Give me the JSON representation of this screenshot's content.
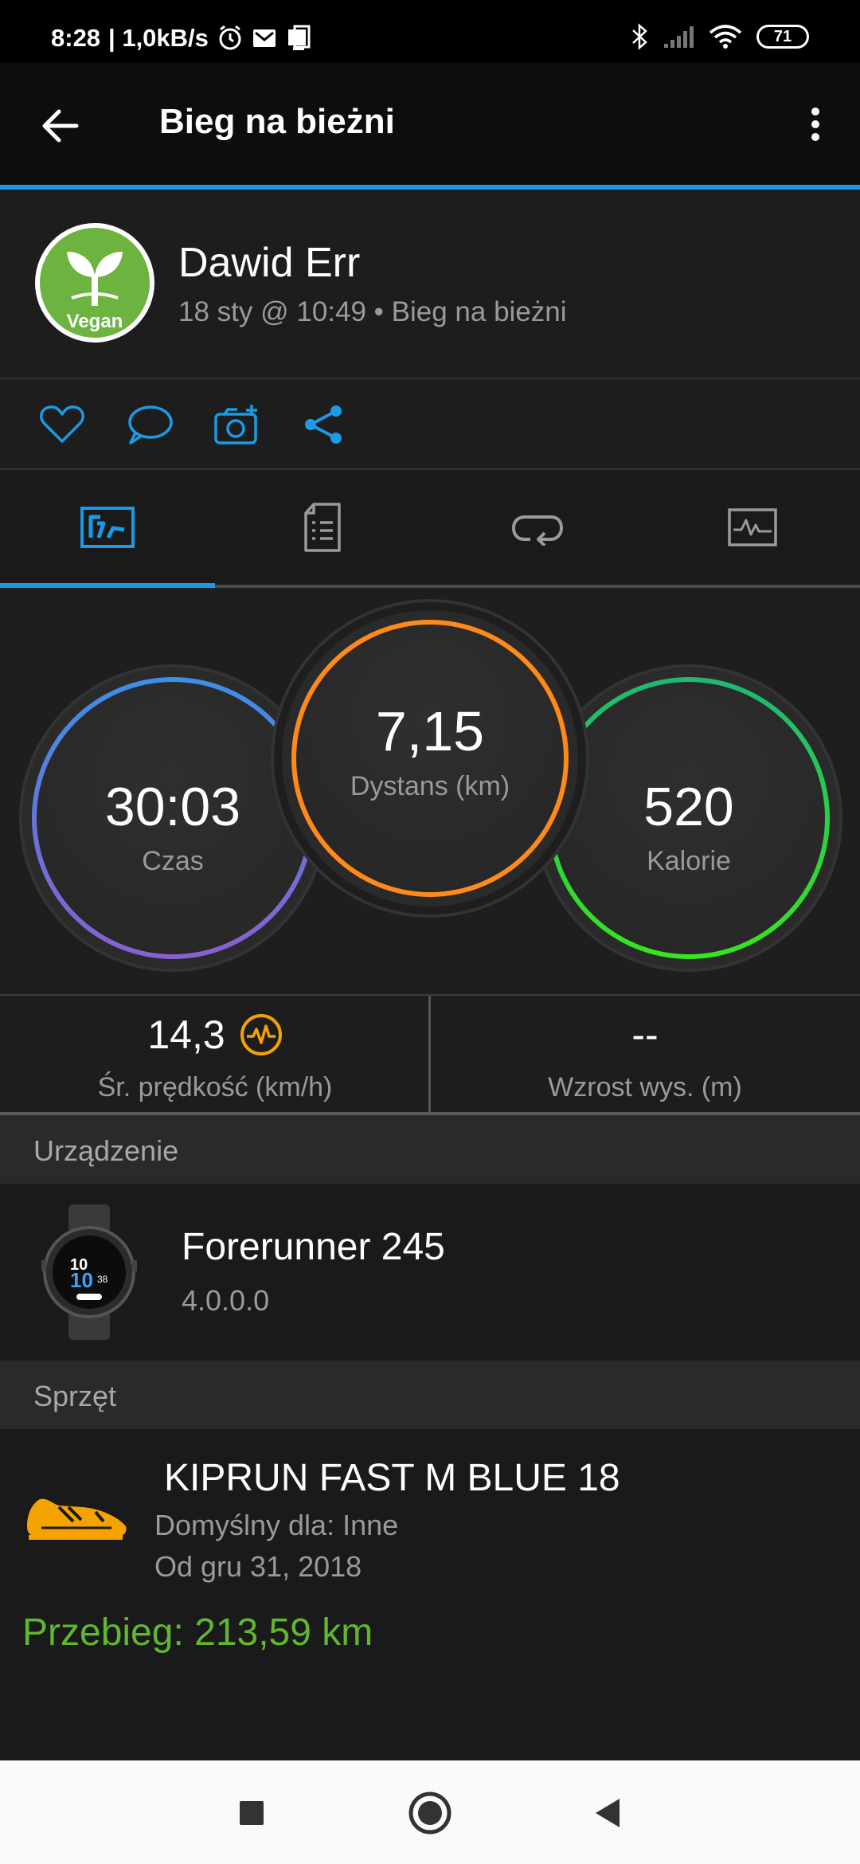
{
  "status_bar": {
    "time": "8:28",
    "speed": "| 1,0kB/s",
    "battery": "71"
  },
  "app_bar": {
    "title": "Bieg na bieżni"
  },
  "profile": {
    "name": "Dawid Err",
    "meta": "18 sty @ 10:49 • Bieg na bieżni",
    "avatar_text": "Vegan"
  },
  "rings": {
    "time": {
      "value": "30:03",
      "label": "Czas",
      "colors": [
        "#3c8fe8",
        "#8a5fd0"
      ]
    },
    "distance": {
      "value": "7,15",
      "label": "Dystans (km)",
      "color": "#ff8a1a"
    },
    "calories": {
      "value": "520",
      "label": "Kalorie",
      "colors": [
        "#1fb873",
        "#37e51e"
      ]
    }
  },
  "stats": {
    "speed": {
      "value": "14,3",
      "label": "Śr. prędkość (km/h)"
    },
    "elevation": {
      "value": "--",
      "label": "Wzrost wys. (m)"
    }
  },
  "device_section": {
    "header": "Urządzenie",
    "name": "Forerunner 245",
    "version": "4.0.0.0"
  },
  "gear_section": {
    "header": "Sprzęt",
    "name": "KIPRUN FAST M BLUE 18",
    "default_for": "Domyślny dla: Inne",
    "since": "Od gru 31, 2018",
    "mileage": "Przebieg: 213,59 km"
  },
  "colors": {
    "accent_blue": "#1a9be6",
    "mileage_green": "#5fb82e",
    "shoe_orange": "#f5a300"
  }
}
